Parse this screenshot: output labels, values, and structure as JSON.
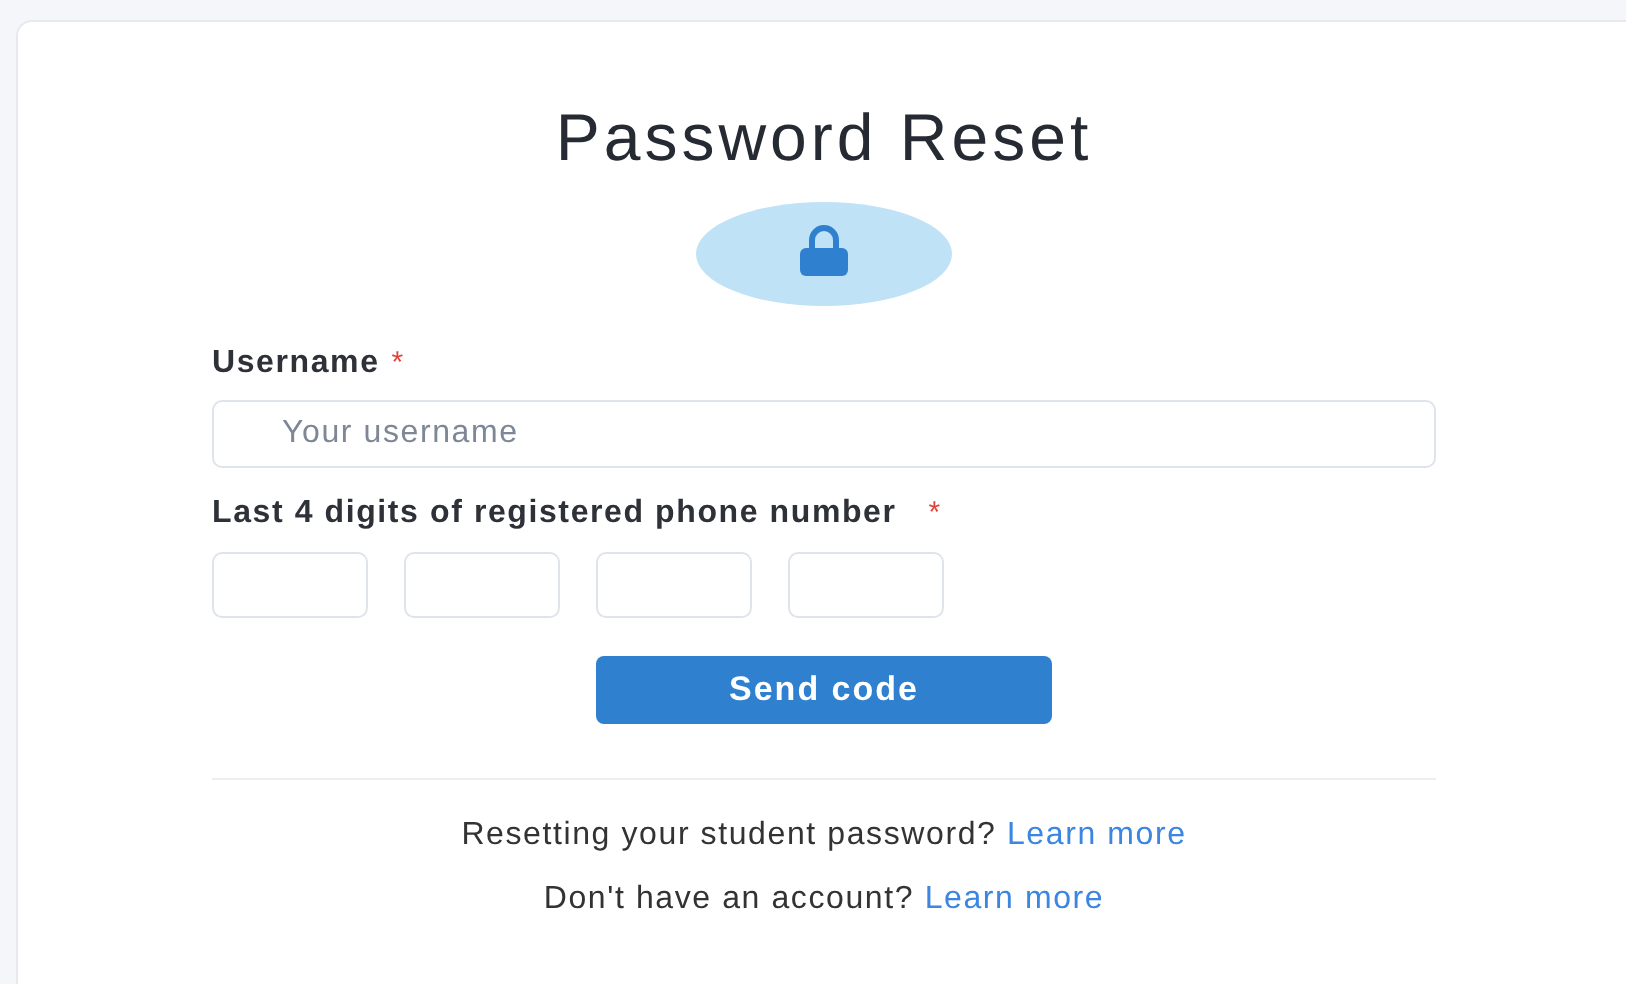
{
  "title": "Password Reset",
  "username": {
    "label": "Username",
    "required_mark": "*",
    "placeholder": "Your username"
  },
  "phone_digits": {
    "label": "Last 4 digits of registered phone number",
    "required_mark": "*"
  },
  "submit_button": "Send code",
  "footer": [
    {
      "text": "Resetting your student password?",
      "link": "Learn more"
    },
    {
      "text": "Don't have an account?",
      "link": "Learn more"
    }
  ]
}
